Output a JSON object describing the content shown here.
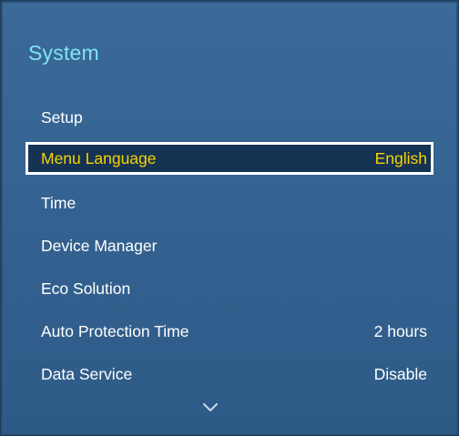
{
  "header": {
    "title": "System"
  },
  "menu": {
    "items": [
      {
        "label": "Setup",
        "value": ""
      },
      {
        "label": "Menu Language",
        "value": "English",
        "selected": true
      },
      {
        "label": "Time",
        "value": ""
      },
      {
        "label": "Device Manager",
        "value": ""
      },
      {
        "label": "Eco Solution",
        "value": ""
      },
      {
        "label": "Auto Protection Time",
        "value": "2 hours"
      },
      {
        "label": "Data Service",
        "value": "Disable"
      }
    ],
    "scroll_indicator_icon": "chevron-down-icon"
  },
  "colors": {
    "title": "#7fe3f3",
    "panel_background": "#356392",
    "selected_background": "#163354",
    "selected_text": "#f7d200",
    "text": "#ffffff"
  }
}
